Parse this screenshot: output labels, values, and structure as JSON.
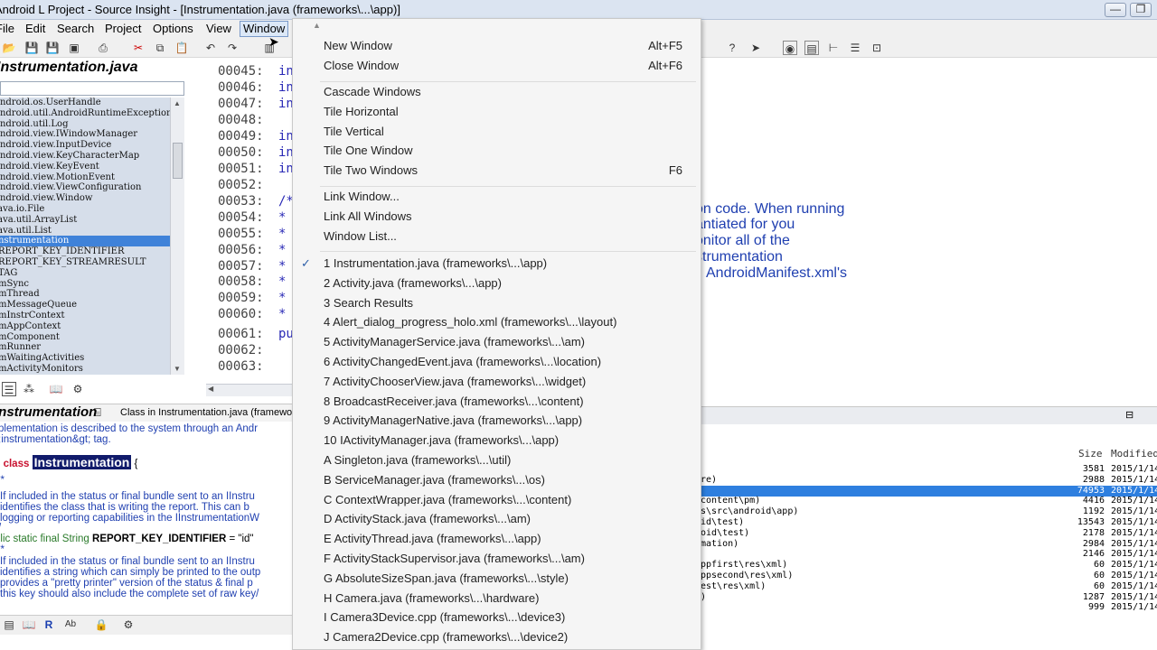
{
  "window": {
    "title": "Android L Project - Source Insight - [Instrumentation.java (frameworks\\...\\app)]",
    "controls": [
      "—",
      "❐",
      "✕"
    ]
  },
  "menubar": [
    "File",
    "Edit",
    "Search",
    "Project",
    "Options",
    "View",
    "Window"
  ],
  "symbol_panel": {
    "title": "Instrumentation.java",
    "items": [
      "android.os.UserHandle",
      "android.util.AndroidRuntimeException",
      "android.util.Log",
      "android.view.IWindowManager",
      "android.view.InputDevice",
      "android.view.KeyCharacterMap",
      "android.view.KeyEvent",
      "android.view.MotionEvent",
      "android.view.ViewConfiguration",
      "android.view.Window",
      "java.io.File",
      "java.util.ArrayList",
      "java.util.List",
      "Instrumentation",
      "REPORT_KEY_IDENTIFIER",
      "REPORT_KEY_STREAMRESULT",
      "TAG",
      "mSync",
      "mThread",
      "mMessageQueue",
      "mInstrContext",
      "mAppContext",
      "mComponent",
      "mRunner",
      "mWaitingActivities",
      "mActivityMonitors"
    ],
    "selected_index": 13
  },
  "code": {
    "lines": [
      {
        "num": "00045:",
        "text": "in"
      },
      {
        "num": "00046:",
        "text": "in"
      },
      {
        "num": "00047:",
        "text": "in"
      },
      {
        "num": "00048:",
        "text": ""
      },
      {
        "num": "00049:",
        "text": "in"
      },
      {
        "num": "00050:",
        "text": "in"
      },
      {
        "num": "00051:",
        "text": "in"
      },
      {
        "num": "00052:",
        "text": ""
      },
      {
        "num": "00053:",
        "text": "/*"
      },
      {
        "num": "00054:",
        "text": "*"
      },
      {
        "num": "00055:",
        "text": "*"
      },
      {
        "num": "00056:",
        "text": "*"
      },
      {
        "num": "00057:",
        "text": "*"
      },
      {
        "num": "00058:",
        "text": "*"
      },
      {
        "num": "00059:",
        "text": "*"
      },
      {
        "num": "00060:",
        "text": "*"
      },
      {
        "num": "00061:",
        "text": "pu"
      },
      {
        "num": "00062:",
        "text": ""
      },
      {
        "num": "00063:",
        "text": ""
      }
    ],
    "right_text": [
      "on code.  When running",
      "antiated for you",
      "onitor all of the",
      "strumentation",
      "AndroidManifest.xml's"
    ]
  },
  "context_panel": {
    "title": "Instrumentation",
    "subtitle": "Class in Instrumentation.java (frameworks",
    "lines": [
      "plementation is described to the system through an Andr",
      ";instrumentation&gt; tag.",
      "",
      "c class",
      "Instrumentation",
      " {",
      "**",
      "  If included in the status or final bundle sent to an IInstru",
      "  identifies the class that is writing the report.  This can b",
      "  logging or reporting capabilities in the IInstrumentationW",
      "/",
      "blic static final String",
      "REPORT_KEY_IDENTIFIER",
      " = \"id\"",
      "**",
      "  If included in the status or final bundle sent to an IInstru",
      "  identifies a string which can simply be printed to the outp",
      "  provides a \"pretty printer\" version of the status & final p",
      "  this key should also include the complete set of raw key/"
    ]
  },
  "window_menu": {
    "group1": [
      {
        "label": "New Window",
        "shortcut": "Alt+F5"
      },
      {
        "label": "Close Window",
        "shortcut": "Alt+F6"
      }
    ],
    "group2": [
      {
        "label": "Cascade Windows",
        "shortcut": ""
      },
      {
        "label": "Tile Horizontal",
        "shortcut": ""
      },
      {
        "label": "Tile Vertical",
        "shortcut": ""
      },
      {
        "label": "Tile One Window",
        "shortcut": ""
      },
      {
        "label": "Tile Two Windows",
        "shortcut": "F6"
      }
    ],
    "group3": [
      {
        "label": "Link Window...",
        "shortcut": ""
      },
      {
        "label": "Link All Windows",
        "shortcut": ""
      },
      {
        "label": "Window List...",
        "shortcut": ""
      }
    ],
    "files": [
      {
        "label": "1  Instrumentation.java (frameworks\\...\\app)",
        "checked": true
      },
      {
        "label": "2  Activity.java (frameworks\\...\\app)",
        "checked": false
      },
      {
        "label": "3  Search Results",
        "checked": false
      },
      {
        "label": "4  Alert_dialog_progress_holo.xml (frameworks\\...\\layout)",
        "checked": false
      },
      {
        "label": "5  ActivityManagerService.java (frameworks\\...\\am)",
        "checked": false
      },
      {
        "label": "6  ActivityChangedEvent.java (frameworks\\...\\location)",
        "checked": false
      },
      {
        "label": "7  ActivityChooserView.java (frameworks\\...\\widget)",
        "checked": false
      },
      {
        "label": "8  BroadcastReceiver.java (frameworks\\...\\content)",
        "checked": false
      },
      {
        "label": "9  ActivityManagerNative.java (frameworks\\...\\app)",
        "checked": false
      },
      {
        "label": "10 IActivityManager.java (frameworks\\...\\app)",
        "checked": false
      },
      {
        "label": "A  Singleton.java (frameworks\\...\\util)",
        "checked": false
      },
      {
        "label": "B  ServiceManager.java (frameworks\\...\\os)",
        "checked": false
      },
      {
        "label": "C  ContextWrapper.java (frameworks\\...\\content)",
        "checked": false
      },
      {
        "label": "D  ActivityStack.java (frameworks\\...\\am)",
        "checked": false
      },
      {
        "label": "E  ActivityThread.java (frameworks\\...\\app)",
        "checked": false
      },
      {
        "label": "F  ActivityStackSupervisor.java (frameworks\\...\\am)",
        "checked": false
      },
      {
        "label": "G  AbsoluteSizeSpan.java (frameworks\\...\\style)",
        "checked": false
      },
      {
        "label": "H  Camera.java (frameworks\\...\\hardware)",
        "checked": false
      },
      {
        "label": "I  Camera3Device.cpp (frameworks\\...\\device3)",
        "checked": false
      },
      {
        "label": "J  Camera2Device.cpp (frameworks\\...\\device2)",
        "checked": false
      }
    ]
  },
  "file_list": {
    "headers": {
      "size": "Size",
      "modified": "Modified"
    },
    "rows": [
      {
        "path": "",
        "size": "3581",
        "modified": "2015/1/14"
      },
      {
        "path": "re)",
        "size": "2988",
        "modified": "2015/1/14"
      },
      {
        "path": "",
        "size": "74953",
        "modified": "2015/1/14",
        "selected": true
      },
      {
        "path": "content\\pm)",
        "size": "4416",
        "modified": "2015/1/14"
      },
      {
        "path": "s\\src\\android\\app)",
        "size": "1192",
        "modified": "2015/1/14"
      },
      {
        "path": "id\\test)",
        "size": "13543",
        "modified": "2015/1/14"
      },
      {
        "path": "oid\\test)",
        "size": "2178",
        "modified": "2015/1/14"
      },
      {
        "path": "mation)",
        "size": "2984",
        "modified": "2015/1/14"
      },
      {
        "path": "",
        "size": "2146",
        "modified": "2015/1/14"
      },
      {
        "path": "ppfirst\\res\\xml)",
        "size": "60",
        "modified": "2015/1/14"
      },
      {
        "path": "ppsecond\\res\\xml)",
        "size": "60",
        "modified": "2015/1/14"
      },
      {
        "path": "est\\res\\xml)",
        "size": "60",
        "modified": "2015/1/14"
      },
      {
        "path": ")",
        "size": "1287",
        "modified": "2015/1/14"
      },
      {
        "path": "",
        "size": "999",
        "modified": "2015/1/14"
      }
    ]
  }
}
